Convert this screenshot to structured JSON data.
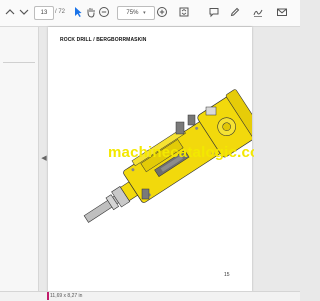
{
  "toolbar": {
    "page_current": "13",
    "page_total": "/ 72",
    "zoom": "75%",
    "icons": [
      "page-up-icon",
      "page-down-icon",
      "cursor-icon",
      "hand-icon",
      "zoom-out-icon",
      "zoom-in-icon",
      "fit-page-icon",
      "comment-icon",
      "pen-icon",
      "sign-icon",
      "mail-icon"
    ]
  },
  "document": {
    "title": "ROCK DRILL / BERGBORRMASKIN",
    "watermark": "machinecatalogic.com",
    "page_number": "15"
  },
  "status_bar": {
    "page_size": "11,69 x 8,27 in"
  },
  "colors": {
    "machine_yellow": "#f2d90c",
    "accent": "#c01c6b"
  }
}
